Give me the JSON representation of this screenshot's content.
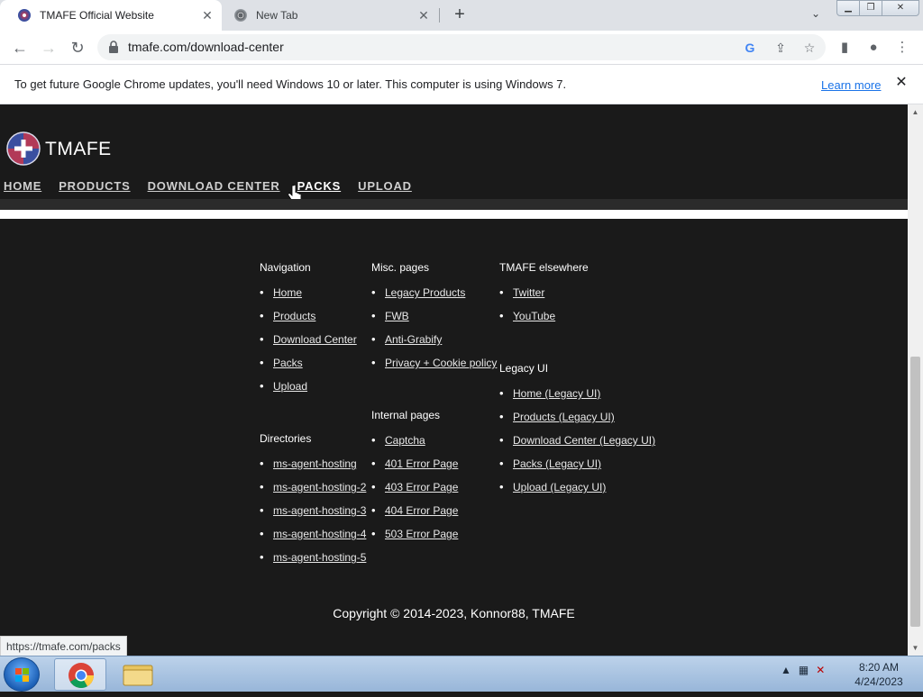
{
  "browser": {
    "tabs": [
      {
        "title": "TMAFE Official Website"
      },
      {
        "title": "New Tab"
      }
    ],
    "url": "tmafe.com/download-center",
    "infobar": {
      "message": "To get future Google Chrome updates, you'll need Windows 10 or later. This computer is using Windows 7.",
      "link": "Learn more"
    },
    "status_url": "https://tmafe.com/packs"
  },
  "site": {
    "brand": "TMAFE",
    "nav": [
      "HOME",
      "PRODUCTS",
      "DOWNLOAD CENTER",
      "PACKS",
      "UPLOAD"
    ],
    "footer": {
      "navigation": {
        "title": "Navigation",
        "items": [
          "Home",
          "Products",
          "Download Center",
          "Packs",
          "Upload"
        ]
      },
      "directories": {
        "title": "Directories",
        "items": [
          "ms-agent-hosting",
          "ms-agent-hosting-2",
          "ms-agent-hosting-3",
          "ms-agent-hosting-4",
          "ms-agent-hosting-5"
        ]
      },
      "misc": {
        "title": "Misc. pages",
        "items": [
          "Legacy Products",
          "FWB",
          "Anti-Grabify",
          "Privacy + Cookie policy"
        ]
      },
      "internal": {
        "title": "Internal pages",
        "items": [
          "Captcha",
          "401 Error Page",
          "403 Error Page",
          "404 Error Page",
          "503 Error Page"
        ]
      },
      "elsewhere": {
        "title": "TMAFE elsewhere",
        "items": [
          "Twitter",
          "YouTube"
        ]
      },
      "legacy": {
        "title": "Legacy UI",
        "items": [
          "Home (Legacy UI)",
          "Products (Legacy UI)",
          "Download Center (Legacy UI)",
          "Packs (Legacy UI)",
          "Upload (Legacy UI)"
        ]
      },
      "copyright": "Copyright © 2014-2023, Konnor88, TMAFE"
    }
  },
  "taskbar": {
    "time": "8:20 AM",
    "date": "4/24/2023"
  },
  "colors": {
    "page_bg": "#1a1a1a",
    "link_blue": "#1a73e8"
  }
}
